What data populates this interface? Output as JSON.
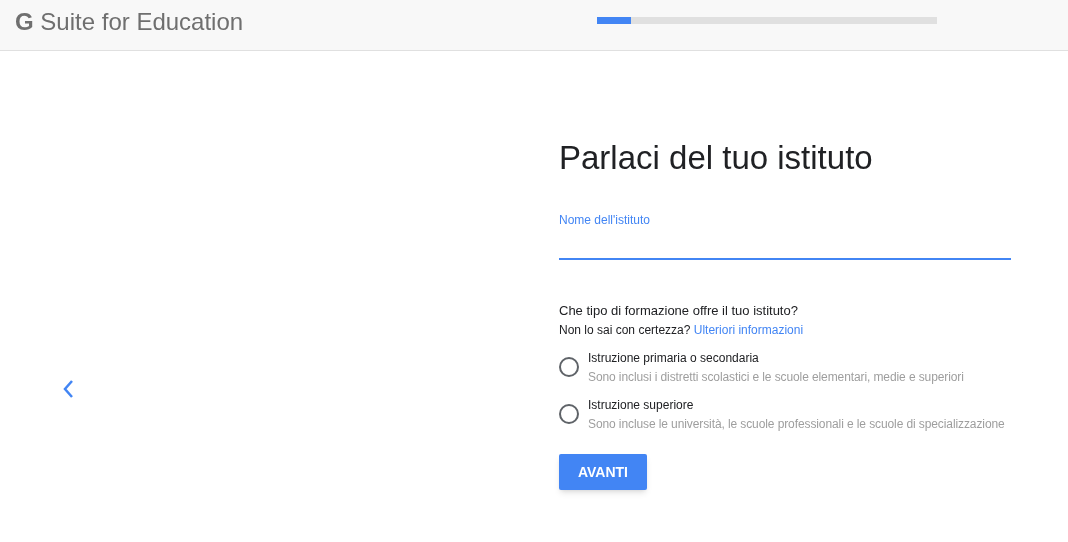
{
  "header": {
    "logo": "**G** Suite for Education",
    "progress": {
      "level": 0.1
    }
  },
  "form": {
    "title": "Parlaci del tuo istituto",
    "name_field": {
      "label": "Nome dell'istituto",
      "focused": true
    },
    "question": "Che tipo di formazione offre il tuo istituto?",
    "hint": "Non lo sai con certezza?",
    "hint_link": "Ulteriori informazioni",
    "options": [
      {
        "label": "Istruzione primaria o secondaria",
        "description": "Sono inclusi i distretti scolastici e le scuole elementari, medie e superiori",
        "selected": false
      },
      {
        "label": "Istruzione superiore",
        "description": "Sono incluse le università, le scuole professionali e le scuole di specializzazione",
        "selected": false
      }
    ],
    "button": "AVANTI"
  }
}
